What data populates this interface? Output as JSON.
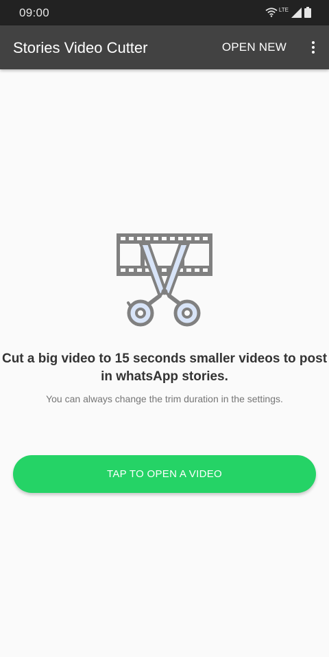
{
  "status_bar": {
    "time": "09:00",
    "network_label": "LTE",
    "icons": [
      "wifi-icon",
      "signal-icon",
      "battery-icon"
    ]
  },
  "app_bar": {
    "title": "Stories Video Cutter",
    "action_label": "OPEN NEW",
    "overflow_icon": "more-vert-icon"
  },
  "main": {
    "illustration": "scissors-film-icon",
    "headline": "Cut a big video to 15 seconds smaller videos to post in whatsApp stories.",
    "subtext": "You can always change the trim duration in the settings.",
    "button_label": "TAP TO OPEN A VIDEO"
  },
  "colors": {
    "status_bar": "#222222",
    "app_bar": "#424242",
    "background": "#fafafa",
    "accent": "#25d366",
    "icon_gray": "#7d7d7d",
    "icon_fill": "#d8e4f8"
  }
}
